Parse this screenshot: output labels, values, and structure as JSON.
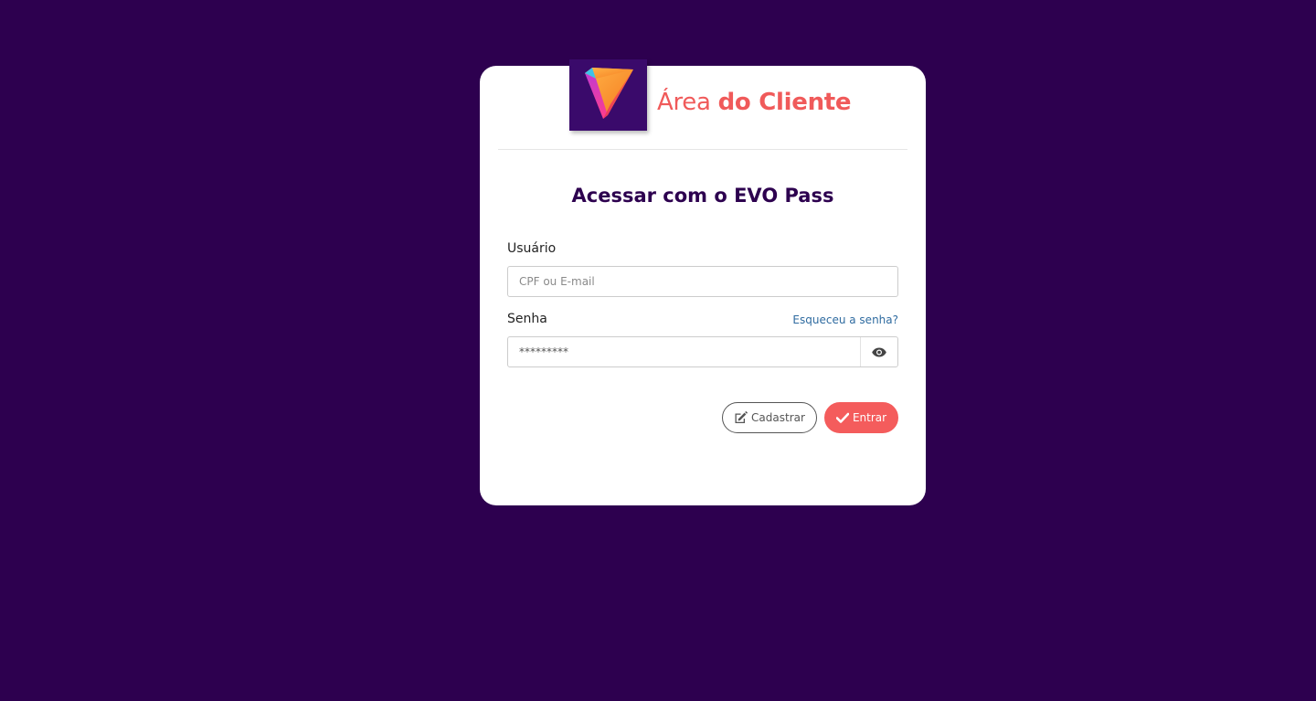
{
  "page": {
    "background": "#2d004f"
  },
  "header": {
    "title_light": "Área",
    "title_bold": "do Cliente",
    "title_color": "#f05a5a",
    "logo_background": "#3a0a6b"
  },
  "form": {
    "heading": "Acessar com o EVO Pass",
    "user_label": "Usuário",
    "user_placeholder": "CPF ou E-mail",
    "user_value": "",
    "password_label": "Senha",
    "password_value": "*********",
    "password_toggle_icon": "eye-icon",
    "forgot_link": "Esqueceu a senha?"
  },
  "actions": {
    "register_label": "Cadastrar",
    "register_icon": "edit-icon",
    "login_label": "Entrar",
    "login_icon": "check-icon",
    "login_color": "#f45c5c",
    "link_color": "#2f6ba0"
  }
}
